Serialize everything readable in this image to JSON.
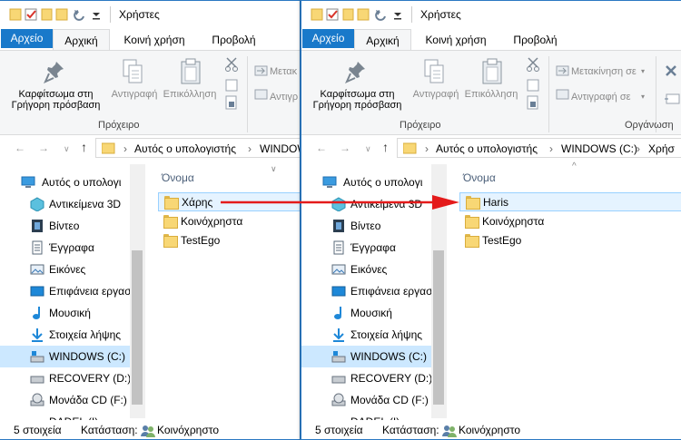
{
  "left": {
    "title": "Χρήστες",
    "tabs": [
      "Αρχείο",
      "Αρχική",
      "Κοινή χρήση",
      "Προβολή"
    ],
    "ribbon": {
      "pin": "Καρφίτσωμα στη Γρήγορη πρόσβαση",
      "copy": "Αντιγραφή",
      "paste": "Επικόλληση",
      "move": "Μετακ",
      "copyto": "Αντιγρ",
      "group": "Πρόχειρο"
    },
    "address": [
      "Αυτός ο υπολογιστής",
      "WINDOWS"
    ],
    "nav": [
      "Αυτός ο υπολογι",
      "Αντικείμενα 3D",
      "Βίντεο",
      "Έγγραφα",
      "Εικόνες",
      "Επιφάνεια εργασ",
      "Μουσική",
      "Στοιχεία λήψης",
      "WINDOWS (C:)",
      "RECOVERY (D:)",
      "Μονάδα CD (F:)",
      "DADEL (I)"
    ],
    "column": "Όνομα",
    "files": [
      "Χάρης",
      "Κοινόχρηστα",
      "TestEgo"
    ],
    "status": {
      "count": "5 στοιχεία",
      "state_label": "Κατάσταση:",
      "state": "Κοινόχρηστο"
    }
  },
  "right": {
    "title": "Χρήστες",
    "tabs": [
      "Αρχείο",
      "Αρχική",
      "Κοινή χρήση",
      "Προβολή"
    ],
    "ribbon": {
      "pin": "Καρφίτσωμα στη Γρήγορη πρόσβαση",
      "copy": "Αντιγραφή",
      "paste": "Επικόλληση",
      "move": "Μετακίνηση σε",
      "copyto": "Αντιγραφή σε",
      "group": "Πρόχειρο",
      "group2": "Οργάνωση"
    },
    "address": [
      "Αυτός ο υπολογιστής",
      "WINDOWS (C:)",
      "Χρήσ"
    ],
    "nav": [
      "Αυτός ο υπολογι",
      "Αντικείμενα 3D",
      "Βίντεο",
      "Έγγραφα",
      "Εικόνες",
      "Επιφάνεια εργασ",
      "Μουσική",
      "Στοιχεία λήψης",
      "WINDOWS (C:)",
      "RECOVERY (D:)",
      "Μονάδα CD (F:)",
      "DADEL (I)"
    ],
    "column": "Όνομα",
    "files": [
      "Haris",
      "Κοινόχρηστα",
      "TestEgo"
    ],
    "status": {
      "count": "5 στοιχεία",
      "state_label": "Κατάσταση:",
      "state": "Κοινόχρηστο"
    }
  },
  "colors": {
    "accent": "#1979ca",
    "arrow": "#e41b1b",
    "selection": "#cce8ff"
  }
}
